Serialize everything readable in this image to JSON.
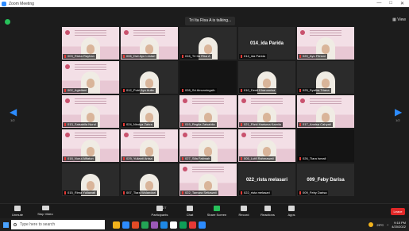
{
  "window": {
    "title": "Zoom Meeting",
    "controls": [
      "—",
      "□",
      "✕"
    ]
  },
  "meeting": {
    "speaking": "Tri Ita Risa A is talking...",
    "view_label": "View",
    "page_left": "1/2",
    "page_right": "1/2"
  },
  "tiles": [
    {
      "label": "003_Rizka Rayhan",
      "kind": "slide"
    },
    {
      "label": "006_Dwi Ayu Lestari",
      "kind": "slide"
    },
    {
      "label": "016_Tri Ita Risa A",
      "kind": "face"
    },
    {
      "label": "014_ida Parida",
      "kind": "namecard",
      "name": "014_ida Parida"
    },
    {
      "label": "020_Ayu Fitriani",
      "kind": "slide"
    },
    {
      "label": "002_Agistiani",
      "kind": "slide"
    },
    {
      "label": "012_Putri Ayu Aulia",
      "kind": "face"
    },
    {
      "label": "028_Sri Ainunningsih",
      "kind": "dark"
    },
    {
      "label": "010_Desti Kharunnisa",
      "kind": "face"
    },
    {
      "label": "025_Syafira Triana",
      "kind": "face"
    },
    {
      "label": "013_Salsabila Nurul",
      "kind": "slide"
    },
    {
      "label": "024_Nindya Zahra",
      "kind": "face"
    },
    {
      "label": "019_Regita Zalsabila",
      "kind": "slide"
    },
    {
      "label": "021_Rizki Harisma Kamila",
      "kind": "slide"
    },
    {
      "label": "017_Annisa Cahyati",
      "kind": "slide"
    },
    {
      "label": "018_Nurul Alfiatun",
      "kind": "slide"
    },
    {
      "label": "029_Yulianti Anisa",
      "kind": "slide"
    },
    {
      "label": "027_Sifa Fatimah",
      "kind": "slide"
    },
    {
      "label": "005_Lutfi Rahmawati",
      "kind": "slide"
    },
    {
      "label": "026_Tiara Ismail",
      "kind": "dark"
    },
    {
      "label": "015_Rima Yuliawati",
      "kind": "face"
    },
    {
      "label": "007_Tiara Wulandari",
      "kind": "face"
    },
    {
      "label": "022_Tamara Setiawati",
      "kind": "slide"
    },
    {
      "label": "022_rista melasari",
      "kind": "namecard",
      "name": "022_rista melasari"
    },
    {
      "label": "009_Feby Darisa",
      "kind": "namecard",
      "name": "009_Feby Darisa"
    }
  ],
  "toolbar": {
    "unmute": "Unmute",
    "stop_video": "Stop Video",
    "participants": "Participants",
    "participants_count": "27",
    "chat": "Chat",
    "share_screen": "Share Screen",
    "record": "Record",
    "reactions": "Reactions",
    "apps": "Apps",
    "leave": "Leave"
  },
  "taskbar": {
    "search_placeholder": "Type here to search",
    "weather": "29°C",
    "time": "9:18 PM",
    "date": "4/20/2022",
    "app_colors": [
      "#f2b31c",
      "#2d8cff",
      "#e34b26",
      "#23a455",
      "#9b59b6",
      "#1e88e5",
      "#ffffff",
      "#0f9d58",
      "#e53935",
      "#2d8cff"
    ]
  },
  "colors": {
    "accent": "#2d8cff",
    "leave": "#e02828",
    "share": "#27c15a"
  }
}
